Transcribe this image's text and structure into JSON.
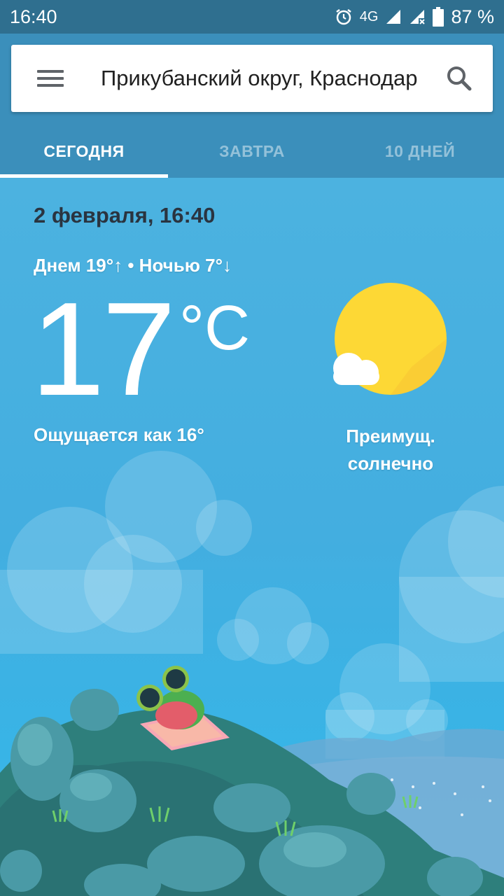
{
  "status_bar": {
    "time": "16:40",
    "network": "4G",
    "battery": "87 %"
  },
  "search": {
    "location": "Прикубанский округ, Краснодар"
  },
  "tabs": [
    {
      "label": "СЕГОДНЯ",
      "active": true
    },
    {
      "label": "ЗАВТРА",
      "active": false
    },
    {
      "label": "10 ДНЕЙ",
      "active": false
    }
  ],
  "weather": {
    "date_time": "2 февраля, 16:40",
    "day_night": "Днем 19°↑ • Ночью 7°↓",
    "temperature": "17",
    "unit": "°C",
    "feels_like": "Ощущается как 16°",
    "condition_line1": "Преимущ.",
    "condition_line2": "солнечно"
  },
  "icons": {
    "menu": "menu-icon",
    "search": "search-icon",
    "weather": "partly-sunny-icon"
  },
  "colors": {
    "header": "#3b8fbb",
    "status_bar": "#2f6f8f",
    "sky": "#4ab3e0",
    "sun": "#fdd835"
  }
}
